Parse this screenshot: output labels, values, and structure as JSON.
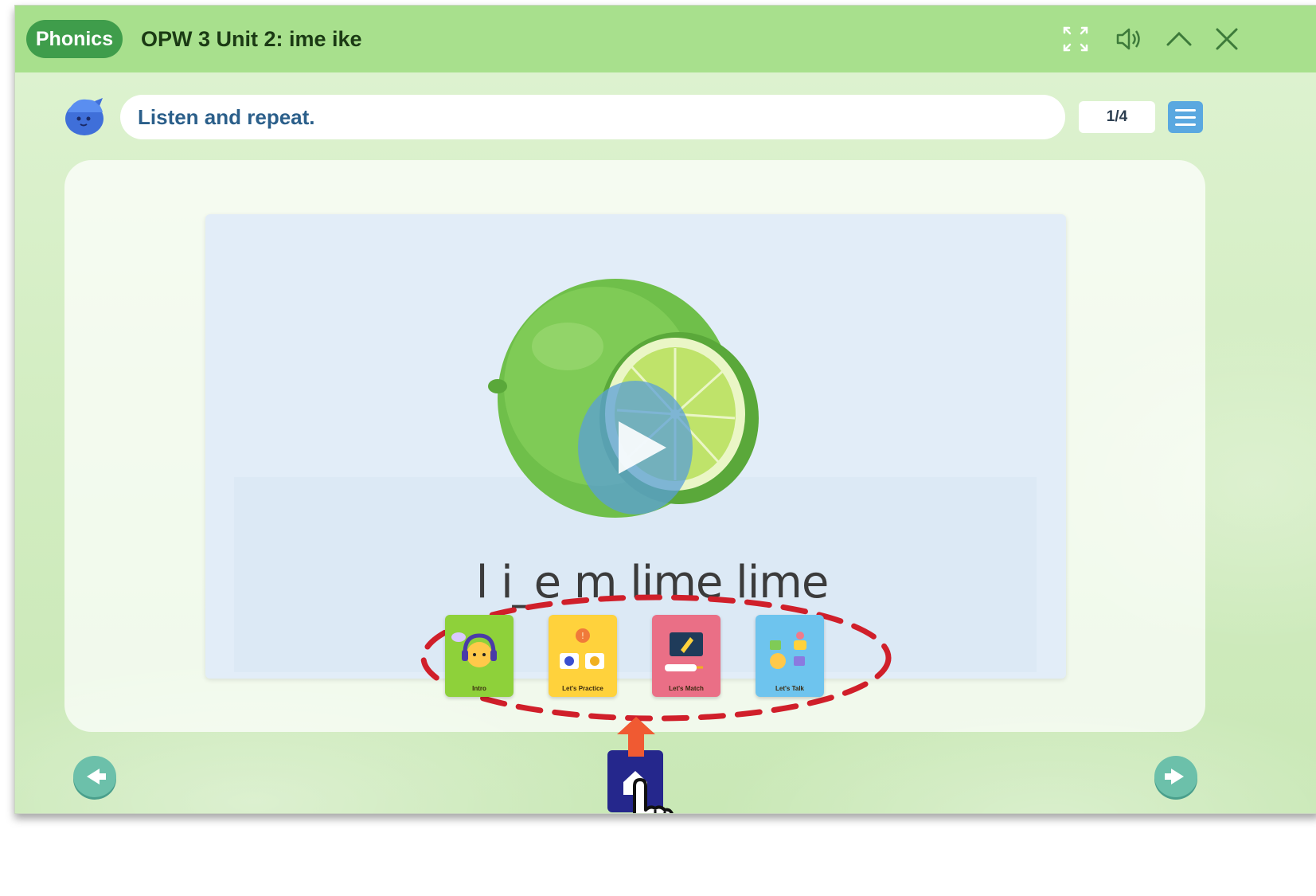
{
  "header": {
    "badge": "Phonics",
    "title": "OPW 3 Unit 2: ime ike",
    "icons": [
      "fullscreen-icon",
      "speaker-icon",
      "chevron-up-icon",
      "close-icon"
    ]
  },
  "instruction": {
    "text": "Listen and repeat.",
    "page_counter": "1/4"
  },
  "stage": {
    "word_line": "l i_e m lime lime",
    "image": "lime",
    "play_icon": "play-icon"
  },
  "activities": [
    {
      "label": "Intro",
      "color": "#8ed13a"
    },
    {
      "label": "Let's Practice",
      "color": "#ffd23c"
    },
    {
      "label": "Let's Match",
      "color": "#ea6f86"
    },
    {
      "label": "Let's Talk",
      "color": "#6ec4ee"
    }
  ],
  "navigation": {
    "prev_icon": "arrow-left-icon",
    "home_icon": "home-icon",
    "next_icon": "arrow-right-icon"
  },
  "colors": {
    "title_bar": "#a8e08d",
    "badge": "#3f9d4b",
    "accent_red": "#d01f2a",
    "arrow_orange": "#f05a32",
    "home_navy": "#25278c"
  }
}
